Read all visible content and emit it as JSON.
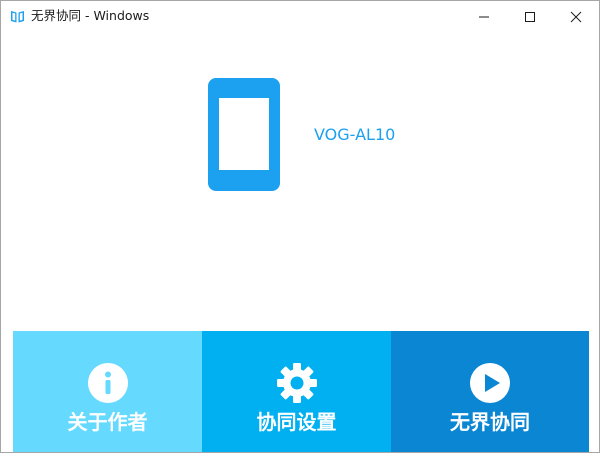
{
  "window": {
    "title": "无界协同 - Windows",
    "app_icon": "book-icon",
    "caption_buttons": {
      "minimize_icon": "minimize-icon",
      "maximize_icon": "maximize-icon",
      "close_icon": "close-icon"
    }
  },
  "device": {
    "icon": "phone-icon",
    "name": "VOG-AL10",
    "accent_color": "#1ca0f0"
  },
  "actions": [
    {
      "label": "关于作者",
      "icon": "info-icon",
      "color": "#66d9ff"
    },
    {
      "label": "协同设置",
      "icon": "gear-icon",
      "color": "#00b0f0"
    },
    {
      "label": "无界协同",
      "icon": "play-icon",
      "color": "#0a86d3"
    }
  ]
}
